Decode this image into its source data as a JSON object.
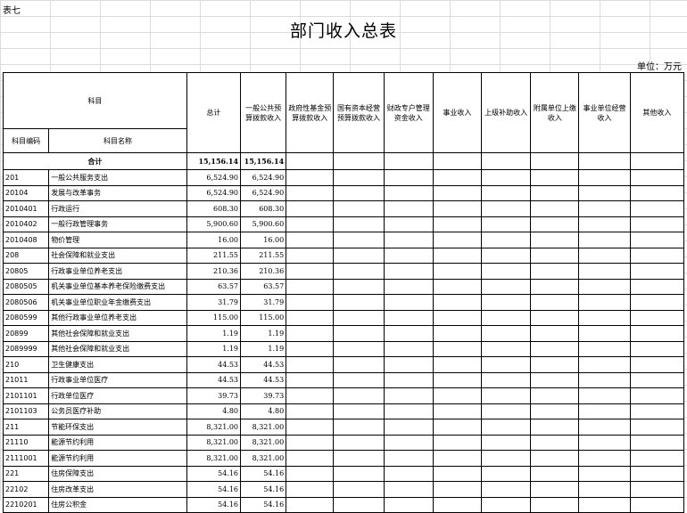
{
  "sheet_tag": "表七",
  "title": "部门收入总表",
  "unit": "单位：万元",
  "headers": {
    "subject": "科目",
    "code": "科目编码",
    "name": "科目名称",
    "total": "总计",
    "general": "一般公共预算拨款收入",
    "gov_fund": "政府性基金预算拨款收入",
    "state_capital": "国有资本经营预算拨款收入",
    "special_fund": "财政专户管理资金收入",
    "business": "事业收入",
    "subsidy": "上级补助收入",
    "affiliated": "附属单位上缴收入",
    "operating": "事业单位经营收入",
    "other": "其他收入"
  },
  "total_row": {
    "label": "合计",
    "total": "15,156.14",
    "general": "15,156.14"
  },
  "rows": [
    {
      "code": "201",
      "name": "一般公共服务支出",
      "total": "6,524.90",
      "general": "6,524.90"
    },
    {
      "code": "20104",
      "name": "发展与改革事务",
      "total": "6,524.90",
      "general": "6,524.90"
    },
    {
      "code": "2010401",
      "name": "行政运行",
      "total": "608.30",
      "general": "608.30"
    },
    {
      "code": "2010402",
      "name": "一般行政管理事务",
      "total": "5,900.60",
      "general": "5,900.60"
    },
    {
      "code": "2010408",
      "name": "物价管理",
      "total": "16.00",
      "general": "16.00"
    },
    {
      "code": "208",
      "name": "社会保障和就业支出",
      "total": "211.55",
      "general": "211.55"
    },
    {
      "code": "20805",
      "name": "行政事业单位养老支出",
      "total": "210.36",
      "general": "210.36"
    },
    {
      "code": "2080505",
      "name": "机关事业单位基本养老保险缴费支出",
      "total": "63.57",
      "general": "63.57"
    },
    {
      "code": "2080506",
      "name": "机关事业单位职业年金缴费支出",
      "total": "31.79",
      "general": "31.79"
    },
    {
      "code": "2080599",
      "name": "其他行政事业单位养老支出",
      "total": "115.00",
      "general": "115.00"
    },
    {
      "code": "20899",
      "name": "其他社会保障和就业支出",
      "total": "1.19",
      "general": "1.19"
    },
    {
      "code": "2089999",
      "name": "其他社会保障和就业支出",
      "total": "1.19",
      "general": "1.19"
    },
    {
      "code": "210",
      "name": "卫生健康支出",
      "total": "44.53",
      "general": "44.53"
    },
    {
      "code": "21011",
      "name": "行政事业单位医疗",
      "total": "44.53",
      "general": "44.53"
    },
    {
      "code": "2101101",
      "name": "行政单位医疗",
      "total": "39.73",
      "general": "39.73"
    },
    {
      "code": "2101103",
      "name": "公务员医疗补助",
      "total": "4.80",
      "general": "4.80"
    },
    {
      "code": "211",
      "name": "节能环保支出",
      "total": "8,321.00",
      "general": "8,321.00"
    },
    {
      "code": "21110",
      "name": "能源节约利用",
      "total": "8,321.00",
      "general": "8,321.00"
    },
    {
      "code": "2111001",
      "name": "能源节约利用",
      "total": "8,321.00",
      "general": "8,321.00"
    },
    {
      "code": "221",
      "name": "住房保障支出",
      "total": "54.16",
      "general": "54.16"
    },
    {
      "code": "22102",
      "name": "住房改革支出",
      "total": "54.16",
      "general": "54.16"
    },
    {
      "code": "2210201",
      "name": "住房公积金",
      "total": "54.16",
      "general": "54.16"
    }
  ]
}
